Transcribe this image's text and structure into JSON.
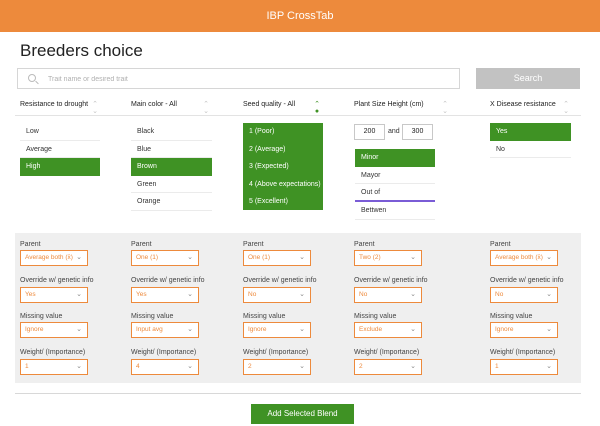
{
  "app": {
    "title": "IBP CrossTab"
  },
  "page": {
    "title": "Breeders choice"
  },
  "search": {
    "placeholder": "Trait name or desired trait",
    "button_label": "Search"
  },
  "columns": {
    "drought": {
      "header": "Resistance to drought",
      "options": [
        "Low",
        "Average",
        "High"
      ],
      "selected": "High"
    },
    "color": {
      "header": "Main color - All",
      "options": [
        "Black",
        "Blue",
        "Brown",
        "Green",
        "Orange"
      ],
      "selected": "Brown"
    },
    "seed": {
      "header": "Seed quality - All",
      "options": [
        "1 (Poor)",
        "2 (Average)",
        "3 (Expected)",
        "4 (Above expectations)",
        "5 (Excellent)"
      ],
      "selected": "all"
    },
    "size": {
      "header": "Plant Size Height (cm)",
      "min": "200",
      "and_label": "and",
      "max": "300",
      "options": [
        "Minor",
        "Mayor",
        "Out of",
        "Bettwen"
      ],
      "selected": "Minor"
    },
    "disease": {
      "header": "X Disease resistance",
      "options": [
        "Yes",
        "No"
      ],
      "selected": "Yes"
    }
  },
  "settings": {
    "labels": {
      "parent": "Parent",
      "override": "Override w/ genetic info",
      "missing": "Missing value",
      "weight": "Weight/ (Importance)"
    },
    "drought": {
      "parent": "Average both (x̄)",
      "override": "Yes",
      "missing": "Ignore",
      "weight": "1"
    },
    "color": {
      "parent": "One (1)",
      "override": "Yes",
      "missing": "Input avg",
      "weight": "4"
    },
    "seed": {
      "parent": "One (1)",
      "override": "No",
      "missing": "Ignore",
      "weight": "2"
    },
    "size": {
      "parent": "Two (2)",
      "override": "No",
      "missing": "Exclude",
      "weight": "2"
    },
    "disease": {
      "parent": "Average both (x̄)",
      "override": "No",
      "missing": "Ignore",
      "weight": "1"
    }
  },
  "footer": {
    "add_button": "Add Selected Blend"
  },
  "colors": {
    "accent": "#ed8a3c",
    "selected": "#3f9224",
    "panel": "#efefef",
    "disabled_button": "#c2c2c2"
  },
  "icons": {
    "search": "search-icon",
    "sort": "sort-icon",
    "dropdown": "chevron-down-icon"
  }
}
